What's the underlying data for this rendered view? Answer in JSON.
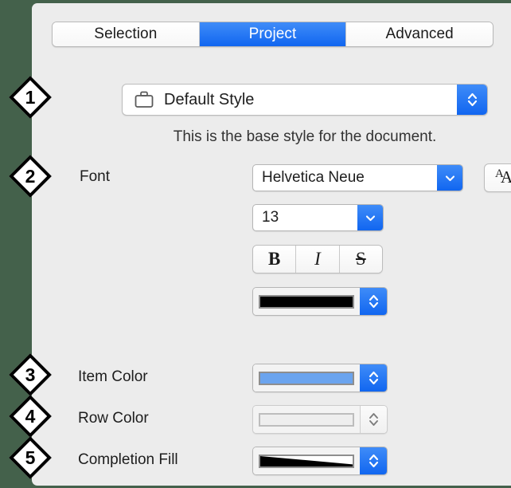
{
  "window": {
    "panel_background": "#ececec",
    "backdrop_color": "#44614b",
    "accent_blue": "#1166f0"
  },
  "tabs": {
    "items": [
      {
        "label": "Selection",
        "selected": false
      },
      {
        "label": "Project",
        "selected": true
      },
      {
        "label": "Advanced",
        "selected": false
      }
    ]
  },
  "style_popup": {
    "icon": "briefcase-icon",
    "value": "Default Style",
    "stepper": "up-down-chevron-icon"
  },
  "description": "This is the base style for the document.",
  "font_section": {
    "label": "Font",
    "family": {
      "value": "Helvetica Neue",
      "chevron": "chevron-down-icon"
    },
    "size": {
      "value": "13",
      "chevron": "chevron-down-icon"
    },
    "font_panel_button": "font-panel-icon",
    "styles": [
      {
        "name": "bold",
        "glyph": "B"
      },
      {
        "name": "italic",
        "glyph": "I"
      },
      {
        "name": "strikethrough",
        "glyph": "S"
      }
    ],
    "text_color": {
      "swatch_color": "#000000",
      "stepper": "up-down-chevron-icon",
      "enabled": true
    }
  },
  "color_rows": [
    {
      "label": "Item Color",
      "swatch_color": "#6ba4ee",
      "enabled": true,
      "stepper": "up-down-chevron-icon"
    },
    {
      "label": "Row Color",
      "swatch_color": "#eeeeee",
      "enabled": false,
      "stepper": "up-down-chevron-icon"
    },
    {
      "label": "Completion Fill",
      "swatch_color": "#000000",
      "enabled": true,
      "fill_style": "black-wedge-gradient",
      "stepper": "up-down-chevron-icon"
    }
  ],
  "callouts": [
    {
      "number": "1"
    },
    {
      "number": "2"
    },
    {
      "number": "3"
    },
    {
      "number": "4"
    },
    {
      "number": "5"
    }
  ]
}
